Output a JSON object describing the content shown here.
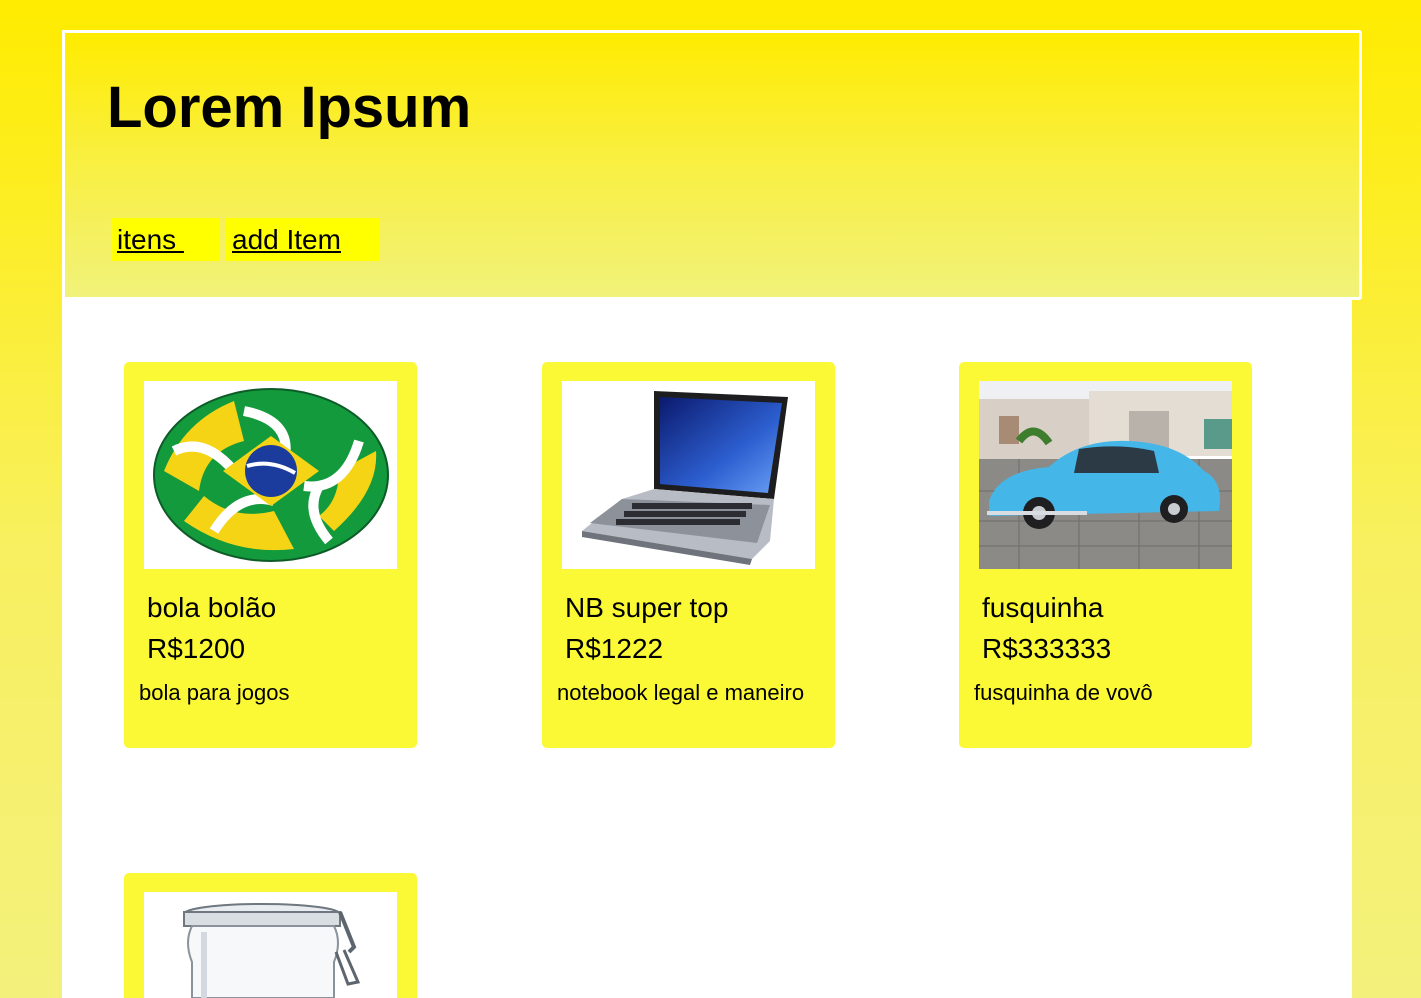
{
  "header": {
    "title": "Lorem Ipsum",
    "nav": [
      {
        "label": "itens "
      },
      {
        "label": "add Item"
      }
    ]
  },
  "items": [
    {
      "name": "bola bolão",
      "price": "R$1200",
      "description": "bola para jogos",
      "image": "soccer-ball-image"
    },
    {
      "name": "NB super top",
      "price": "R$1222",
      "description": "notebook legal e maneiro",
      "image": "laptop-image"
    },
    {
      "name": "fusquinha",
      "price": "R$333333",
      "description": "fusquinha de vovô",
      "image": "blue-beetle-car-image"
    },
    {
      "image": "glass-jar-image"
    }
  ],
  "colors": {
    "background_top": "#ffec00",
    "background_bottom": "#f3f17c",
    "card": "#fbf935",
    "nav_link": "#ffff00"
  }
}
